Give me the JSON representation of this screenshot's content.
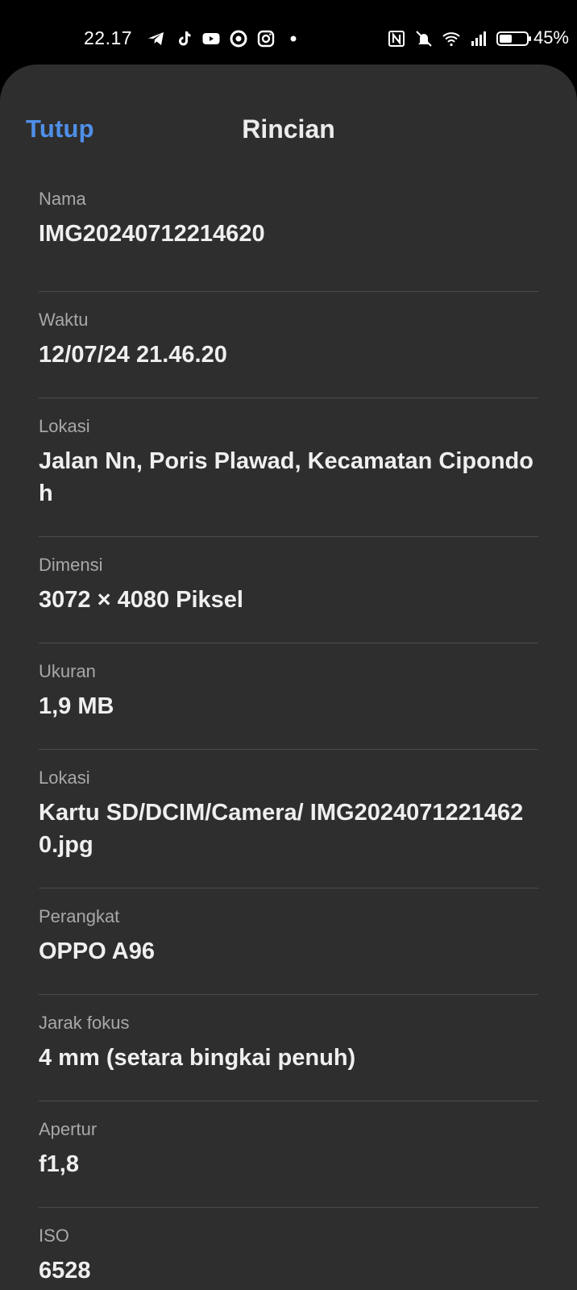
{
  "status_bar": {
    "time": "22.17",
    "battery_percent": "45%",
    "left_icons": [
      "telegram-icon",
      "tiktok-icon",
      "youtube-icon",
      "radar-app-icon",
      "instagram-icon",
      "dot-icon"
    ],
    "right_icons": [
      "nfc-icon",
      "mute-vibrate-icon",
      "wifi-icon",
      "signal-icon",
      "battery-icon"
    ]
  },
  "header": {
    "close_label": "Tutup",
    "title": "Rincian"
  },
  "details": [
    {
      "label": "Nama",
      "value": "IMG20240712214620"
    },
    {
      "label": "Waktu",
      "value": "12/07/24 21.46.20"
    },
    {
      "label": "Lokasi",
      "value": "Jalan Nn, Poris Plawad, Kecamatan Cipondoh"
    },
    {
      "label": "Dimensi",
      "value": "3072 × 4080 Piksel"
    },
    {
      "label": "Ukuran",
      "value": "1,9 MB"
    },
    {
      "label": "Lokasi",
      "value": "Kartu SD/DCIM/Camera/ IMG20240712214620.jpg"
    },
    {
      "label": "Perangkat",
      "value": "OPPO A96"
    },
    {
      "label": "Jarak fokus",
      "value": "4 mm (setara bingkai penuh)"
    },
    {
      "label": "Apertur",
      "value": "f1,8"
    },
    {
      "label": "ISO",
      "value": "6528"
    }
  ],
  "colors": {
    "sheet_bg": "#2e2e2f",
    "accent": "#4f8fe8",
    "label": "#a8a8aa",
    "value": "#efefef"
  }
}
